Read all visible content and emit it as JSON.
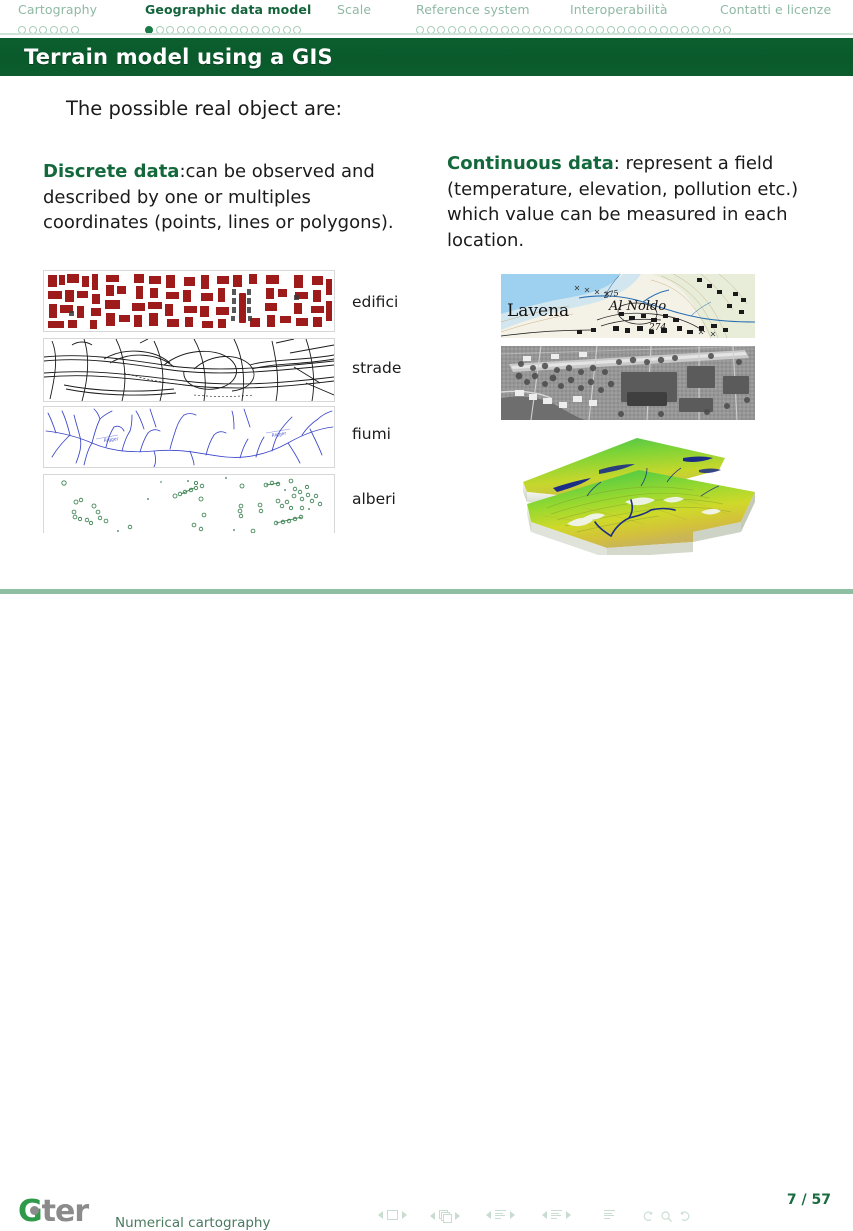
{
  "header": {
    "sections": [
      {
        "label": "Cartography",
        "active": false,
        "dots_total": 6,
        "dots_filled_index": -1
      },
      {
        "label": "Geographic data model",
        "active": true,
        "dots_total": 15,
        "dots_filled_index": 0
      },
      {
        "label": "Scale",
        "active": false,
        "dots_total": 0,
        "dots_filled_index": -1
      },
      {
        "label": "Reference system",
        "active": false,
        "dots_total": 0,
        "dots_filled_index": -1
      },
      {
        "label": "Interoperabilità",
        "active": false,
        "dots_total": 0,
        "dots_filled_index": -1
      },
      {
        "label": "Contatti e licenze",
        "active": false,
        "dots_total": 0,
        "dots_filled_index": -1
      }
    ],
    "right_dots_total": 30,
    "active_color": "#13633b",
    "inactive_color": "#8fb9a4"
  },
  "title": {
    "text": "Terrain model using a GIS",
    "background": "#0c5f2f",
    "color": "#ffffff"
  },
  "body": {
    "intro": "The possible real object are:",
    "left": {
      "keyword": "Discrete data",
      "text": ":can be observed and described by one or multiples coordinates (points, lines or polygons)."
    },
    "right": {
      "keyword": "Continuous data",
      "text": ": represent a field (temperature, elevation, pollution etc.) which value can be measured in each location."
    },
    "keyword_color": "#14693c"
  },
  "figures": {
    "left": [
      {
        "name": "buildings-map",
        "label": "edifici",
        "caption_color": "#1b1b1b",
        "feature_color": "#9e1b1b",
        "geometry": "polygons"
      },
      {
        "name": "roads-map",
        "label": "strade",
        "caption_color": "#1b1b1b",
        "feature_color": "#1a1a1a",
        "geometry": "lines"
      },
      {
        "name": "rivers-map",
        "label": "fiumi",
        "caption_color": "#1b1b1b",
        "feature_color": "#3a46c8",
        "geometry": "lines"
      },
      {
        "name": "trees-map",
        "label": "alberi",
        "caption_color": "#1b1b1b",
        "feature_color": "#2f7a45",
        "geometry": "points"
      }
    ],
    "right": [
      {
        "name": "topographic-map",
        "labels": [
          "Lavena",
          "Al Noldo",
          "275",
          "274"
        ]
      },
      {
        "name": "orthophoto",
        "labels": []
      },
      {
        "name": "dem-3d-block",
        "labels": []
      }
    ]
  },
  "footer": {
    "logo_primary": "G",
    "logo_secondary": "ter",
    "course": "Numerical cartography",
    "page": "7 / 57",
    "nav_symbols": [
      "prev-slide",
      "slide",
      "next-slide",
      "prev-frame",
      "frames",
      "next-frame",
      "prev-subsection",
      "subsection",
      "next-subsection",
      "prev-section",
      "section",
      "next-section",
      "toc",
      "back",
      "search",
      "forward"
    ]
  }
}
